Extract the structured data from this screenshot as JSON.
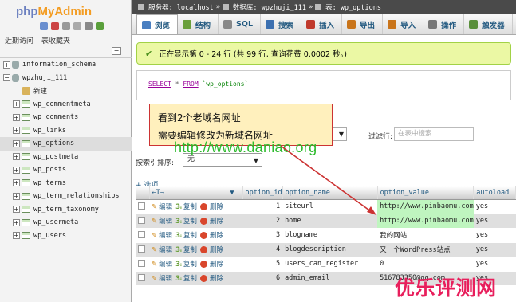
{
  "logo": {
    "part1": "php",
    "part2": "MyAdmin"
  },
  "left_tabs": [
    "近期访问",
    "表收藏夹"
  ],
  "tree": [
    {
      "label": "information_schema",
      "type": "db"
    },
    {
      "label": "wpzhuji_111",
      "type": "db"
    },
    {
      "label": "新建",
      "type": "new"
    },
    {
      "label": "wp_commentmeta",
      "type": "table"
    },
    {
      "label": "wp_comments",
      "type": "table"
    },
    {
      "label": "wp_links",
      "type": "table"
    },
    {
      "label": "wp_options",
      "type": "table",
      "active": true
    },
    {
      "label": "wp_postmeta",
      "type": "table"
    },
    {
      "label": "wp_posts",
      "type": "table"
    },
    {
      "label": "wp_terms",
      "type": "table"
    },
    {
      "label": "wp_term_relationships",
      "type": "table"
    },
    {
      "label": "wp_term_taxonomy",
      "type": "table"
    },
    {
      "label": "wp_usermeta",
      "type": "table"
    },
    {
      "label": "wp_users",
      "type": "table"
    }
  ],
  "breadcrumb": [
    "服务器: localhost",
    "数据库: wpzhuji_111",
    "表: wp_options"
  ],
  "tabs": [
    {
      "label": "浏览",
      "color": "#4a7fc1"
    },
    {
      "label": "结构",
      "color": "#6a9f3b"
    },
    {
      "label": "SQL",
      "color": "#888888"
    },
    {
      "label": "搜索",
      "color": "#3b6fb0"
    },
    {
      "label": "插入",
      "color": "#c0392b"
    },
    {
      "label": "导出",
      "color": "#c9741a"
    },
    {
      "label": "导入",
      "color": "#c9741a"
    },
    {
      "label": "操作",
      "color": "#777777"
    },
    {
      "label": "触发器",
      "color": "#5a8f3b"
    }
  ],
  "notice": "正在显示第 0 - 24 行 (共 99 行, 查询花费 0.0002 秒。)",
  "sql": {
    "select": "SELECT",
    "star": "*",
    "from": "FROM",
    "table": "`wp_options`"
  },
  "annotation": {
    "line1": "看到2个老域名网址",
    "line2": "需要编辑修改为新域名网址"
  },
  "watermark": "http://www.daniao.org",
  "filter": {
    "label": "过滤行:",
    "placeholder": "在表中搜索"
  },
  "sort": {
    "label": "按索引排序:",
    "value": "无"
  },
  "options_link": "+ 选项",
  "columns": [
    "option_id",
    "option_name",
    "option_value",
    "autoload"
  ],
  "actions": {
    "edit": "编辑",
    "copy": "复制",
    "delete": "删除"
  },
  "rows": [
    {
      "id": "1",
      "name": "siteurl",
      "value": "http://www.pinbaomu.com",
      "autoload": "yes",
      "highlight": true
    },
    {
      "id": "2",
      "name": "home",
      "value": "http://www.pinbaomu.com",
      "autoload": "yes",
      "highlight": true
    },
    {
      "id": "3",
      "name": "blogname",
      "value": "我的网站",
      "autoload": "yes"
    },
    {
      "id": "4",
      "name": "blogdescription",
      "value": "又一个WordPress站点",
      "autoload": "yes"
    },
    {
      "id": "5",
      "name": "users_can_register",
      "value": "0",
      "autoload": "yes"
    },
    {
      "id": "6",
      "name": "admin_email",
      "value": "516783350@qq.com",
      "autoload": "yes"
    }
  ],
  "brand": "优乐评测网"
}
